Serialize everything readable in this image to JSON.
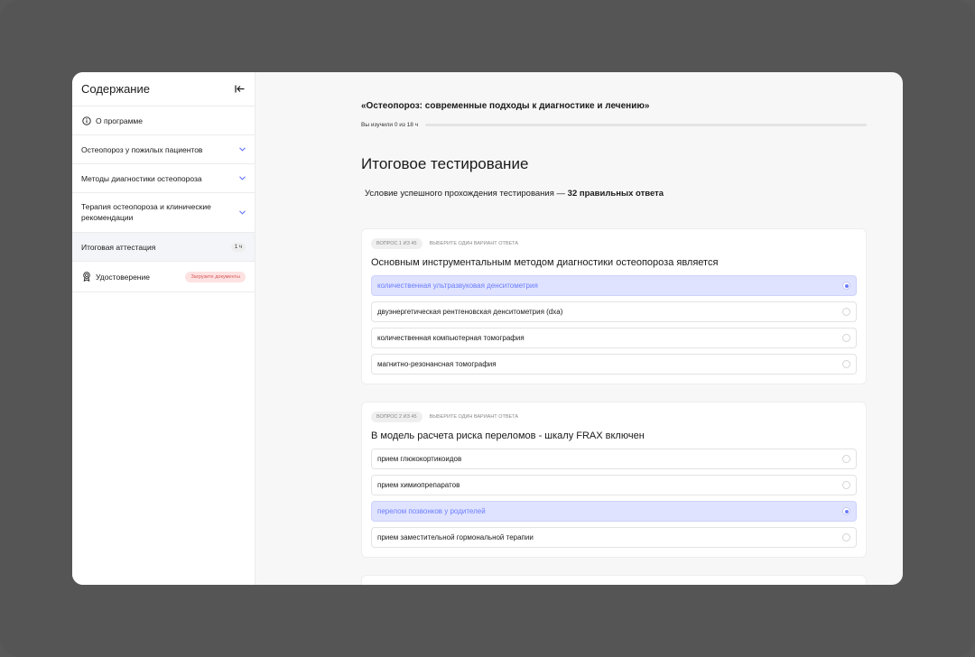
{
  "sidebar": {
    "title": "Содержание",
    "items": [
      {
        "label": "О программе",
        "icon": "info-icon"
      },
      {
        "label": "Остеопороз у пожилых пациентов",
        "icon": "chevron-down-icon"
      },
      {
        "label": "Методы диагностики остеопороза",
        "icon": "chevron-down-icon"
      },
      {
        "label": "Терапия остеопороза и клинические рекомендации",
        "icon": "chevron-down-icon"
      },
      {
        "label": "Итоговая аттестация",
        "tag": "1 ч"
      },
      {
        "label": "Удостоверение",
        "icon": "certificate-icon",
        "tag": "Загрузите документы"
      }
    ]
  },
  "course": {
    "title": "«Остеопороз: современные подходы к диагностике и лечению»",
    "progress_text": "Вы изучили 0 из 18 ч",
    "progress_value": 0
  },
  "test": {
    "heading": "Итоговое тестирование",
    "condition_prefix": "Условие успешного прохождения тестирования — ",
    "condition_bold": "32 правильных ответа"
  },
  "questions": [
    {
      "badge": "ВОПРОС 1 ИЗ 45",
      "instruction": "ВЫБЕРИТЕ ОДИН ВАРИАНТ ОТВЕТА",
      "text": "Основным инструментальным методом диагностики остеопороза является",
      "options": [
        "количественная ультразвуковая денситометрия",
        "двуэнергетическая рентгеновская денситометрия (dxa)",
        "количественная компьютерная томография",
        "магнитно-резонансная томография"
      ],
      "selected": 0
    },
    {
      "badge": "ВОПРОС 2 ИЗ 45",
      "instruction": "ВЫБЕРИТЕ ОДИН ВАРИАНТ ОТВЕТА",
      "text": "В модель расчета риска переломов - шкалу FRAX включен",
      "options": [
        "прием глюкокортикоидов",
        "прием химиопрепаратов",
        "перелом позвонков у родителей",
        "прием заместительной гормональной терапии"
      ],
      "selected": 2
    }
  ],
  "colors": {
    "accent": "#6b7cff",
    "selected_bg": "#dfe3ff",
    "docs_tag_bg": "#fde2e2",
    "docs_tag_text": "#d85656"
  }
}
